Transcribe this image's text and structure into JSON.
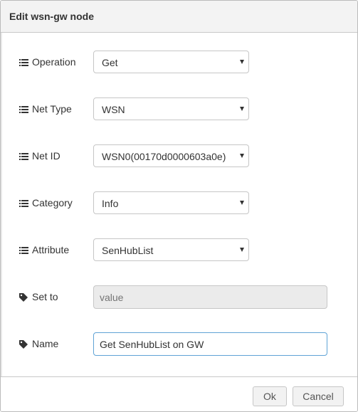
{
  "dialog": {
    "title": "Edit wsn-gw node",
    "fields": {
      "operation": {
        "label": "Operation",
        "value": "Get",
        "icon": "list-icon"
      },
      "net_type": {
        "label": "Net Type",
        "value": "WSN",
        "icon": "list-icon"
      },
      "net_id": {
        "label": "Net ID",
        "value": "WSN0(00170d0000603a0e)",
        "icon": "list-icon"
      },
      "category": {
        "label": "Category",
        "value": "Info",
        "icon": "list-icon"
      },
      "attribute": {
        "label": "Attribute",
        "value": "SenHubList",
        "icon": "list-icon"
      },
      "set_to": {
        "label": "Set to",
        "placeholder": "value",
        "icon": "tag-icon"
      },
      "name": {
        "label": "Name",
        "value": "Get SenHubList on GW",
        "icon": "tag-icon"
      }
    },
    "buttons": {
      "ok": "Ok",
      "cancel": "Cancel"
    }
  }
}
